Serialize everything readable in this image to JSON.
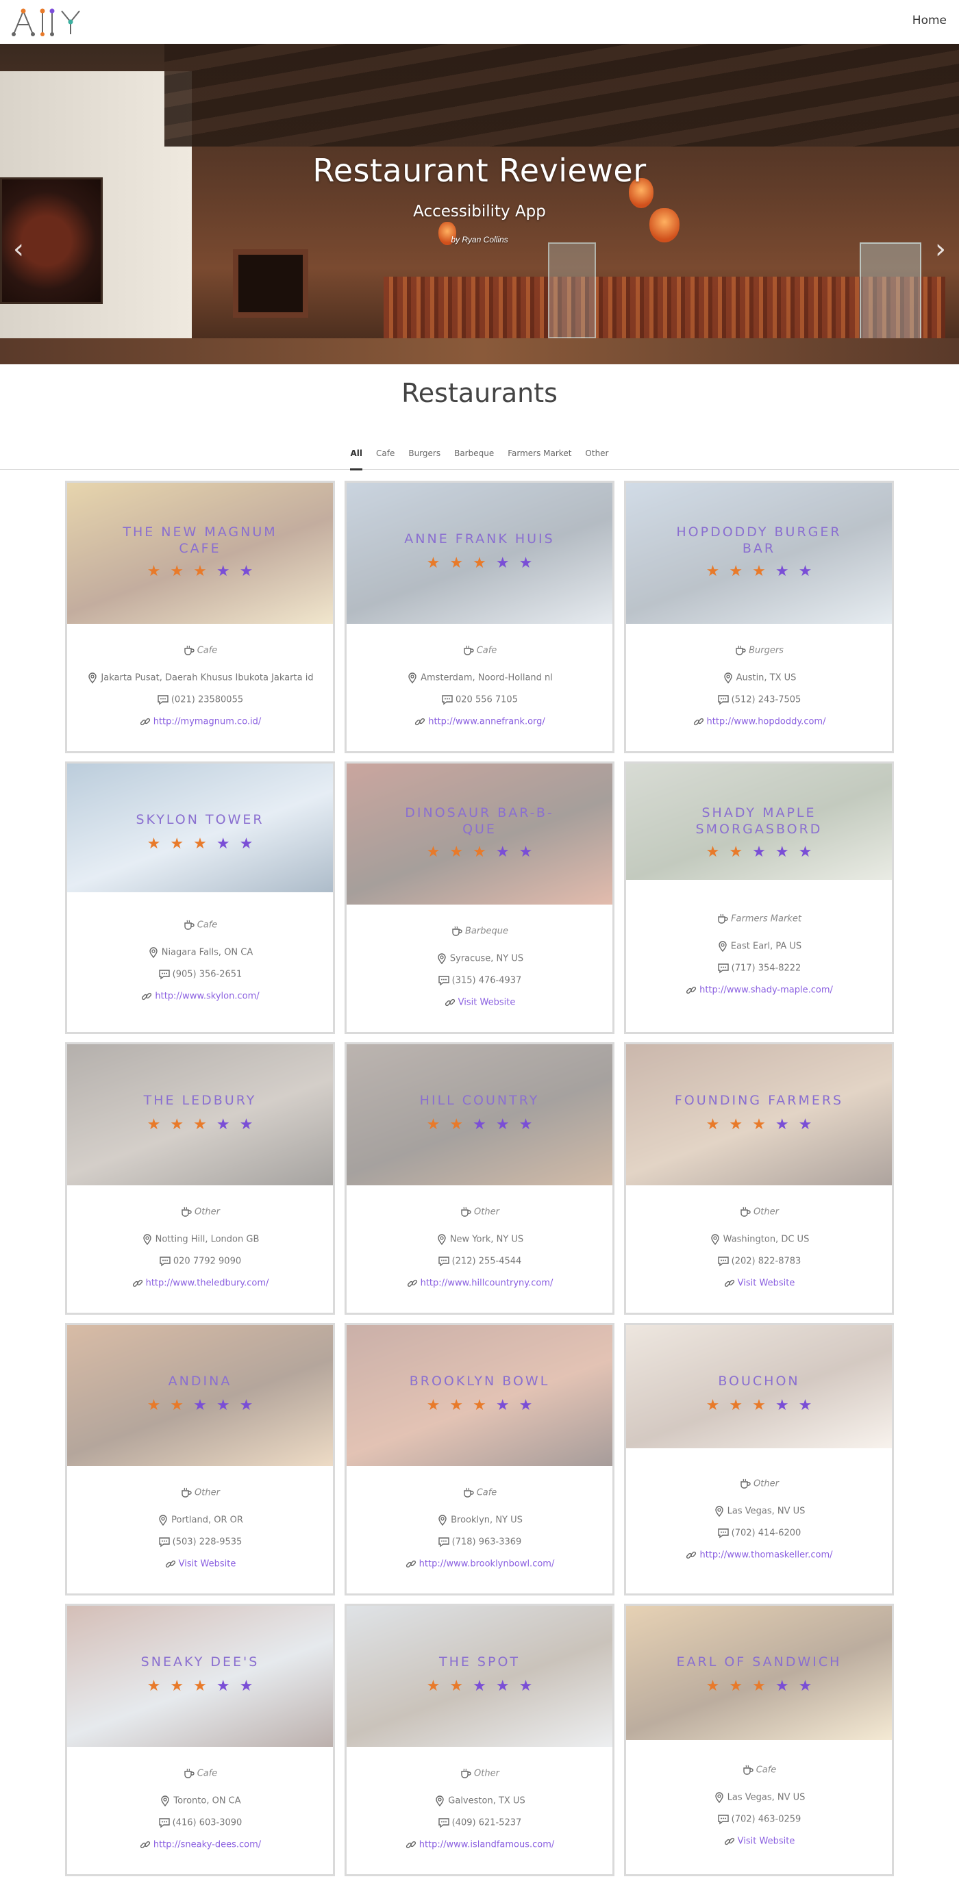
{
  "header": {
    "home_label": "Home",
    "logo_text": "A11Y"
  },
  "hero": {
    "title": "Restaurant Reviewer",
    "subtitle": "Accessibility App",
    "author": "by Ryan Collins",
    "prev_arrow": "‹",
    "next_arrow": "›",
    "slide_count": 4,
    "active_slide": 2
  },
  "section": {
    "title": "Restaurants"
  },
  "tabs": [
    {
      "label": "All",
      "active": true
    },
    {
      "label": "Cafe",
      "active": false
    },
    {
      "label": "Burgers",
      "active": false
    },
    {
      "label": "Barbeque",
      "active": false
    },
    {
      "label": "Farmers Market",
      "active": false
    },
    {
      "label": "Other",
      "active": false
    }
  ],
  "colors": {
    "accent": "#7c4ddb",
    "star_filled": "#e87a2a",
    "star_empty": "#7a4ed6",
    "link": "#8a5fe0"
  },
  "restaurants": [
    {
      "name": "The New Magnum Cafe",
      "rating": 3,
      "type": "Cafe",
      "address": "Jakarta Pusat, Daerah Khusus Ibukota Jakarta id",
      "phone": "(021) 23580055",
      "website": "http://mymagnum.co.id/"
    },
    {
      "name": "Anne Frank Huis",
      "rating": 3,
      "type": "Cafe",
      "address": "Amsterdam, Noord-Holland nl",
      "phone": "020 556 7105",
      "website": "http://www.annefrank.org/"
    },
    {
      "name": "Hopdoddy Burger Bar",
      "rating": 3,
      "type": "Burgers",
      "address": "Austin, TX US",
      "phone": "(512) 243-7505",
      "website": "http://www.hopdoddy.com/"
    },
    {
      "name": "Skylon Tower",
      "rating": 3,
      "type": "Cafe",
      "address": "Niagara Falls, ON CA",
      "phone": "(905) 356-2651",
      "website": "http://www.skylon.com/"
    },
    {
      "name": "Dinosaur Bar-B-Que",
      "rating": 3,
      "type": "Barbeque",
      "address": "Syracuse, NY US",
      "phone": "(315) 476-4937",
      "website": "Visit Website"
    },
    {
      "name": "Shady Maple Smorgasbord",
      "rating": 2,
      "type": "Farmers Market",
      "address": "East Earl, PA US",
      "phone": "(717) 354-8222",
      "website": "http://www.shady-maple.com/"
    },
    {
      "name": "The Ledbury",
      "rating": 3,
      "type": "Other",
      "address": "Notting Hill, London GB",
      "phone": "020 7792 9090",
      "website": "http://www.theledbury.com/"
    },
    {
      "name": "Hill Country",
      "rating": 2,
      "type": "Other",
      "address": "New York, NY US",
      "phone": "(212) 255-4544",
      "website": "http://www.hillcountryny.com/"
    },
    {
      "name": "Founding Farmers",
      "rating": 3,
      "type": "Other",
      "address": "Washington, DC US",
      "phone": "(202) 822-8783",
      "website": "Visit Website"
    },
    {
      "name": "Andina",
      "rating": 2,
      "type": "Other",
      "address": "Portland, OR OR",
      "phone": "(503) 228-9535",
      "website": "Visit Website"
    },
    {
      "name": "Brooklyn Bowl",
      "rating": 3,
      "type": "Cafe",
      "address": "Brooklyn, NY US",
      "phone": "(718) 963-3369",
      "website": "http://www.brooklynbowl.com/"
    },
    {
      "name": "Bouchon",
      "rating": 3,
      "type": "Other",
      "address": "Las Vegas, NV US",
      "phone": "(702) 414-6200",
      "website": "http://www.thomaskeller.com/"
    },
    {
      "name": "Sneaky Dee's",
      "rating": 3,
      "type": "Cafe",
      "address": "Toronto, ON CA",
      "phone": "(416) 603-3090",
      "website": "http://sneaky-dees.com/"
    },
    {
      "name": "The Spot",
      "rating": 2,
      "type": "Other",
      "address": "Galveston, TX US",
      "phone": "(409) 621-5237",
      "website": "http://www.islandfamous.com/"
    },
    {
      "name": "Earl of Sandwich",
      "rating": 3,
      "type": "Cafe",
      "address": "Las Vegas, NV US",
      "phone": "(702) 463-0259",
      "website": "Visit Website"
    }
  ]
}
